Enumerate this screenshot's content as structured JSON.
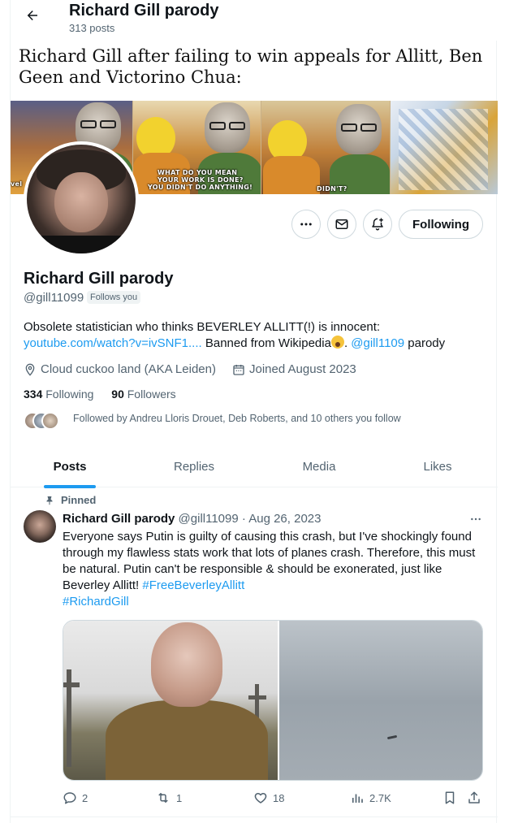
{
  "header": {
    "title": "Richard Gill parody",
    "post_count": "313 posts"
  },
  "banner": {
    "caption": "Richard Gill after failing to win appeals for Allitt, Ben Geen and Victorino Chua:",
    "panel1_text": "vel",
    "panel2_text_1": "WHAT DO YOU MEAN",
    "panel2_text_2": "YOUR WORK IS DONE?",
    "panel2_text_3": "YOU DIDN'T DO ANYTHING!",
    "panel3_text": "DIDN'T?"
  },
  "profile": {
    "name": "Richard Gill parody",
    "handle": "@gill11099",
    "follows_you": "Follows you",
    "following_button": "Following",
    "bio_line1": "Obsolete statistician who thinks BEVERLEY ALLITT(!) is innocent:",
    "bio_link": "youtube.com/watch?v=ivSNF1....",
    "bio_mid": " Banned from Wikipedia",
    "bio_after_emoji": ". ",
    "bio_mention": "@gill1109",
    "bio_end": " parody",
    "location": "Cloud cuckoo land (AKA Leiden)",
    "joined": "Joined August 2023",
    "following_count": "334",
    "following_label": "Following",
    "followers_count": "90",
    "followers_label": "Followers",
    "followed_by": "Followed by Andreu Lloris Drouet, Deb Roberts, and 10 others you follow"
  },
  "tabs": [
    "Posts",
    "Replies",
    "Media",
    "Likes"
  ],
  "post": {
    "pinned_label": "Pinned",
    "author": "Richard Gill parody",
    "handle": "@gill11099",
    "sep": "·",
    "date": "Aug 26, 2023",
    "text": "Everyone says Putin is guilty of causing this crash, but I've shockingly found through my flawless stats work that lots of planes crash. Therefore, this must be natural. Putin can't be responsible & should be exonerated, just like Beverley Allitt! ",
    "hashtag1": "#FreeBeverleyAllitt",
    "hashtag2": "#RichardGill",
    "replies": "2",
    "reposts": "1",
    "likes": "18",
    "views": "2.7K"
  },
  "colors": {
    "accent": "#1d9bf0",
    "text": "#0f1419",
    "secondary": "#536471",
    "border": "#cfd9de"
  }
}
